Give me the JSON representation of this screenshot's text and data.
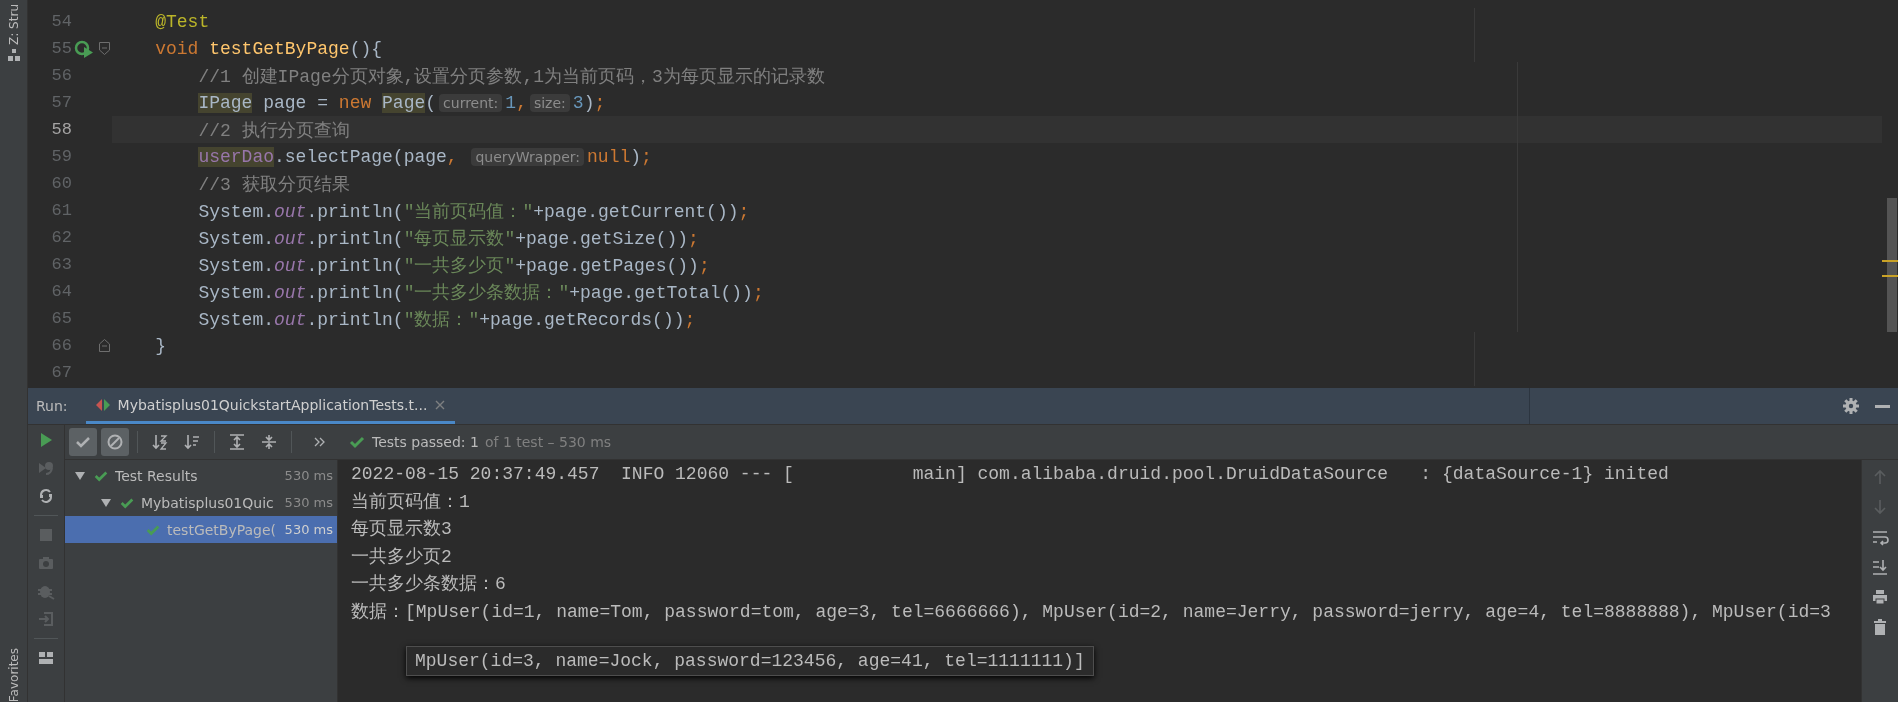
{
  "side_strip": {
    "top_label": "Z: Stru",
    "bottom_label": "Favorites"
  },
  "editor": {
    "lines": [
      {
        "number": "54",
        "current": false,
        "run_marker": false,
        "fold_start": false,
        "fold_end": false,
        "tokens": [
          {
            "text": "@Test",
            "kind": "annotation"
          }
        ]
      },
      {
        "number": "55",
        "current": false,
        "run_marker": true,
        "fold_start": true,
        "fold_end": false,
        "tokens": [
          {
            "text": "void ",
            "kind": "keyword"
          },
          {
            "text": "testGetByPage",
            "kind": "method"
          },
          {
            "text": "(){",
            "kind": "plain"
          }
        ],
        "children": [
          {
            "number": "56",
            "current": false,
            "run_marker": false,
            "fold_start": false,
            "fold_end": false,
            "tokens": [
              {
                "text": "//1 创建IPage分页对象,设置分页参数,1为当前页码，3为每页显示的记录数",
                "kind": "comment"
              }
            ]
          },
          {
            "number": "57",
            "current": false,
            "run_marker": false,
            "fold_start": false,
            "fold_end": false,
            "tokens": [
              {
                "text": "IPage",
                "kind": "usage"
              },
              {
                "text": " page = ",
                "kind": "plain"
              },
              {
                "text": "new ",
                "kind": "keyword"
              },
              {
                "text": "Page",
                "kind": "usage"
              },
              {
                "text": "(",
                "kind": "plain"
              },
              {
                "text": "current:",
                "kind": "hint"
              },
              {
                "text": "1",
                "kind": "number"
              },
              {
                "text": ",",
                "kind": "punct"
              },
              {
                "text": "size:",
                "kind": "hint"
              },
              {
                "text": "3",
                "kind": "number"
              },
              {
                "text": ")",
                "kind": "plain"
              },
              {
                "text": ";",
                "kind": "punct"
              }
            ]
          },
          {
            "number": "58",
            "current": true,
            "run_marker": false,
            "fold_start": false,
            "fold_end": false,
            "tokens": [
              {
                "text": "//2 执行分页查询",
                "kind": "comment"
              }
            ]
          },
          {
            "number": "59",
            "current": false,
            "run_marker": false,
            "fold_start": false,
            "fold_end": false,
            "tokens": [
              {
                "text": "userDao",
                "kind": "usage_field"
              },
              {
                "text": ".selectPage(page",
                "kind": "plain"
              },
              {
                "text": ", ",
                "kind": "punct"
              },
              {
                "text": "queryWrapper:",
                "kind": "hint"
              },
              {
                "text": "null",
                "kind": "keyword"
              },
              {
                "text": ")",
                "kind": "plain"
              },
              {
                "text": ";",
                "kind": "punct"
              }
            ]
          },
          {
            "number": "60",
            "current": false,
            "run_marker": false,
            "fold_start": false,
            "fold_end": false,
            "tokens": [
              {
                "text": "//3 获取分页结果",
                "kind": "comment"
              }
            ]
          },
          {
            "number": "61",
            "current": false,
            "run_marker": false,
            "fold_start": false,
            "fold_end": false,
            "tokens": [
              {
                "text": "System.",
                "kind": "plain"
              },
              {
                "text": "out",
                "kind": "field"
              },
              {
                "text": ".println(",
                "kind": "plain"
              },
              {
                "text": "\"当前页码值：\"",
                "kind": "string"
              },
              {
                "text": "+page.getCurrent())",
                "kind": "plain"
              },
              {
                "text": ";",
                "kind": "punct"
              }
            ]
          },
          {
            "number": "62",
            "current": false,
            "run_marker": false,
            "fold_start": false,
            "fold_end": false,
            "tokens": [
              {
                "text": "System.",
                "kind": "plain"
              },
              {
                "text": "out",
                "kind": "field"
              },
              {
                "text": ".println(",
                "kind": "plain"
              },
              {
                "text": "\"每页显示数\"",
                "kind": "string"
              },
              {
                "text": "+page.getSize())",
                "kind": "plain"
              },
              {
                "text": ";",
                "kind": "punct"
              }
            ]
          },
          {
            "number": "63",
            "current": false,
            "run_marker": false,
            "fold_start": false,
            "fold_end": false,
            "tokens": [
              {
                "text": "System.",
                "kind": "plain"
              },
              {
                "text": "out",
                "kind": "field"
              },
              {
                "text": ".println(",
                "kind": "plain"
              },
              {
                "text": "\"一共多少页\"",
                "kind": "string"
              },
              {
                "text": "+page.getPages())",
                "kind": "plain"
              },
              {
                "text": ";",
                "kind": "punct"
              }
            ]
          },
          {
            "number": "64",
            "current": false,
            "run_marker": false,
            "fold_start": false,
            "fold_end": false,
            "tokens": [
              {
                "text": "System.",
                "kind": "plain"
              },
              {
                "text": "out",
                "kind": "field"
              },
              {
                "text": ".println(",
                "kind": "plain"
              },
              {
                "text": "\"一共多少条数据：\"",
                "kind": "string"
              },
              {
                "text": "+page.getTotal())",
                "kind": "plain"
              },
              {
                "text": ";",
                "kind": "punct"
              }
            ]
          },
          {
            "number": "65",
            "current": false,
            "run_marker": false,
            "fold_start": false,
            "fold_end": false,
            "tokens": [
              {
                "text": "System.",
                "kind": "plain"
              },
              {
                "text": "out",
                "kind": "field"
              },
              {
                "text": ".println(",
                "kind": "plain"
              },
              {
                "text": "\"数据：\"",
                "kind": "string"
              },
              {
                "text": "+page.getRecords())",
                "kind": "plain"
              },
              {
                "text": ";",
                "kind": "punct"
              }
            ]
          }
        ]
      },
      {
        "number": "66",
        "current": false,
        "run_marker": false,
        "fold_start": false,
        "fold_end": true,
        "tokens": [
          {
            "text": "}",
            "kind": "plain"
          }
        ]
      },
      {
        "number": "67",
        "current": false,
        "run_marker": false,
        "fold_start": false,
        "fold_end": false
      }
    ]
  },
  "run_panel": {
    "label": "Run:",
    "tabs": [
      {
        "title": "Mybatisplus01QuickstartApplicationTests.t...",
        "selected": true
      }
    ],
    "side_toolbar": [
      [
        {
          "kind": "run",
          "disabled": false
        },
        {
          "kind": "rerun_failed",
          "disabled": true
        },
        {
          "kind": "auto_rerun",
          "disabled": false
        }
      ],
      [
        {
          "kind": "stop",
          "disabled": true
        },
        {
          "kind": "camera",
          "disabled": true
        },
        {
          "kind": "bug",
          "disabled": true
        },
        {
          "kind": "exit",
          "disabled": true
        }
      ],
      [
        {
          "kind": "layout",
          "disabled": false
        }
      ]
    ],
    "toolbar": [
      [
        {
          "kind": "check",
          "on": true
        },
        {
          "kind": "ignored",
          "on": true
        }
      ],
      [
        {
          "kind": "sort_alpha",
          "on": false
        },
        {
          "kind": "sort_time",
          "on": false
        }
      ],
      [
        {
          "kind": "expand",
          "on": false
        },
        {
          "kind": "collapse",
          "on": false
        }
      ]
    ],
    "status": {
      "passed": "Tests passed: 1",
      "detail": "of 1 test – 530 ms"
    },
    "tree": [
      {
        "label": "Test Results",
        "duration": "530 ms",
        "expanded": true,
        "selected": false,
        "children": [
          {
            "label": "Mybatisplus01Quic",
            "duration": "530 ms",
            "expanded": true,
            "selected": false,
            "children": [
              {
                "label": "testGetByPage(",
                "duration": "530 ms",
                "selected": true
              }
            ]
          }
        ]
      }
    ],
    "console": {
      "lines": [
        "2022-08-15 20:37:49.457  INFO 12060 --- [           main] com.alibaba.druid.pool.DruidDataSource   : {dataSource-1} inited",
        "当前页码值：1",
        "每页显示数3",
        "一共多少页2",
        "一共多少条数据：6",
        "数据：[MpUser(id=1, name=Tom, password=tom, age=3, tel=6666666), MpUser(id=2, name=Jerry, password=jerry, age=4, tel=8888888), MpUser(id=3"
      ],
      "popup": "MpUser(id=3, name=Jock, password=123456, age=41, tel=1111111)]"
    },
    "console_toolbar": [
      {
        "kind": "up",
        "disabled": true
      },
      {
        "kind": "down",
        "disabled": true
      },
      {
        "kind": "wrap",
        "disabled": false
      },
      {
        "kind": "scroll_end",
        "disabled": false
      },
      {
        "kind": "print",
        "disabled": false
      },
      {
        "kind": "trash",
        "disabled": false
      }
    ]
  }
}
